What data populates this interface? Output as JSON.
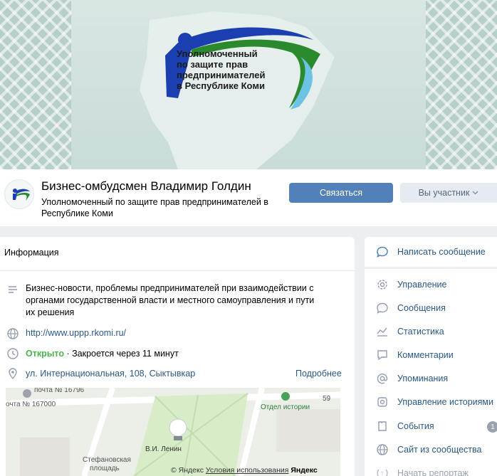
{
  "cover": {
    "logo_lines": [
      "Уполномоченный",
      "по защите прав",
      "предпринимателей",
      "в Республике Коми"
    ]
  },
  "group": {
    "name": "Бизнес-омбудсмен Владимир Голдин",
    "subtitle": "Уполномоченный по защите прав предпринимателей в Республике Коми",
    "contact_button": "Связаться",
    "member_button": "Вы участник"
  },
  "info": {
    "title": "Информация",
    "description": "Бизнес-новости, проблемы предпринимателей при взаимодействии с органами государственной власти и местного самоуправления и пути их решения",
    "url": "http://www.uppp.rkomi.ru/",
    "status_open": "Открыто",
    "status_rest": " · Закроется через 11 минут",
    "address": "ул. Интернациональная, 108, Сыктывкар",
    "more_link": "Подробнее",
    "icons": [
      "text-lines-icon",
      "globe-icon",
      "clock-icon",
      "location-pin-icon"
    ]
  },
  "map": {
    "labels": {
      "post_top": "почта № 16796",
      "post_left": "очта № 167000",
      "museum": "Отдел истории",
      "monument": "В.И. Ленин",
      "square_1": "Стефановская",
      "square_2": "площадь",
      "num": "59"
    },
    "footer": {
      "copyright": "© Яндекс",
      "terms": "Условия использования",
      "brand": "Яндекс"
    }
  },
  "menu": {
    "write_message": "Написать сообщение",
    "items": [
      {
        "label": "Управление",
        "icon": "gear-icon"
      },
      {
        "label": "Сообщения",
        "icon": "speech-bubble-icon"
      },
      {
        "label": "Статистика",
        "icon": "chart-line-icon"
      },
      {
        "label": "Комментарии",
        "icon": "comment-icon"
      },
      {
        "label": "Упоминания",
        "icon": "at-sign-icon"
      },
      {
        "label": "Управление историями",
        "icon": "stories-icon"
      },
      {
        "label": "События",
        "icon": "calendar-icon"
      },
      {
        "label": "Сайт из сообщества",
        "icon": "globe-icon"
      },
      {
        "label": "Начать репортаж",
        "icon": "broadcast-icon"
      }
    ],
    "events_badge": "1"
  },
  "colors": {
    "accent": "#5181b8",
    "link": "#2a5885",
    "open_green": "#4bb34b",
    "background": "#edeef0"
  }
}
